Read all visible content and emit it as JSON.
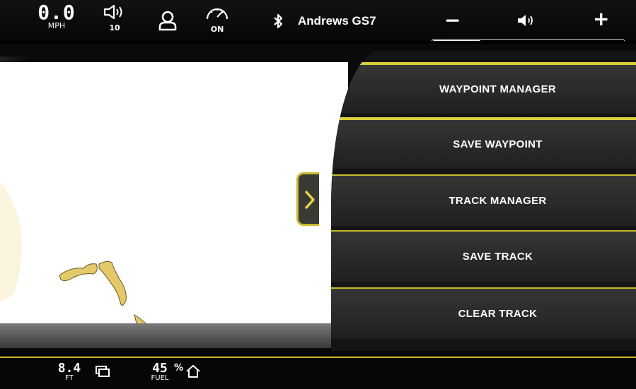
{
  "status_bar": {
    "speed_value": "0.0",
    "speed_unit": "MPH",
    "volume_level": "10",
    "cruise_status": "ON",
    "device_name": "Andrews GS7",
    "volume_minus": "−",
    "volume_plus": "+",
    "volume_fraction": 0.25
  },
  "toggle_icon": "chevron-right-icon",
  "menu": {
    "items": [
      {
        "label": "WAYPOINT MANAGER"
      },
      {
        "label": "SAVE WAYPOINT"
      },
      {
        "label": "TRACK MANAGER"
      },
      {
        "label": "SAVE TRACK"
      },
      {
        "label": "CLEAR TRACK"
      }
    ]
  },
  "bottom_bar": {
    "depth_value": "8.4",
    "depth_unit": "FT",
    "fuel_value": "45",
    "fuel_percent": "%",
    "fuel_label": "FUEL"
  },
  "colors": {
    "accent": "#c9bb2a",
    "land": "#e3c96a",
    "map_background": "#ffffff",
    "panel": "#141414"
  }
}
